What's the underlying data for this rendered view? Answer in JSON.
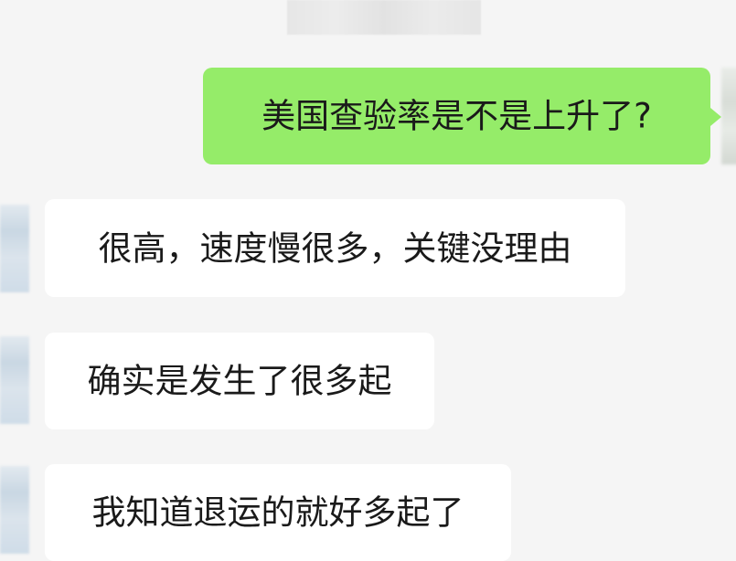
{
  "chat": {
    "timestamp": "",
    "messages": [
      {
        "direction": "outgoing",
        "text": "美国查验率是不是上升了?"
      },
      {
        "direction": "incoming",
        "text": "很高，速度慢很多，关键没理由"
      },
      {
        "direction": "incoming",
        "text": "确实是发生了很多起"
      },
      {
        "direction": "incoming",
        "text": "我知道退运的就好多起了"
      }
    ]
  },
  "colors": {
    "background": "#f5f5f5",
    "outgoing_bubble": "#95ec69",
    "incoming_bubble": "#ffffff",
    "text": "#1a1a1a"
  }
}
